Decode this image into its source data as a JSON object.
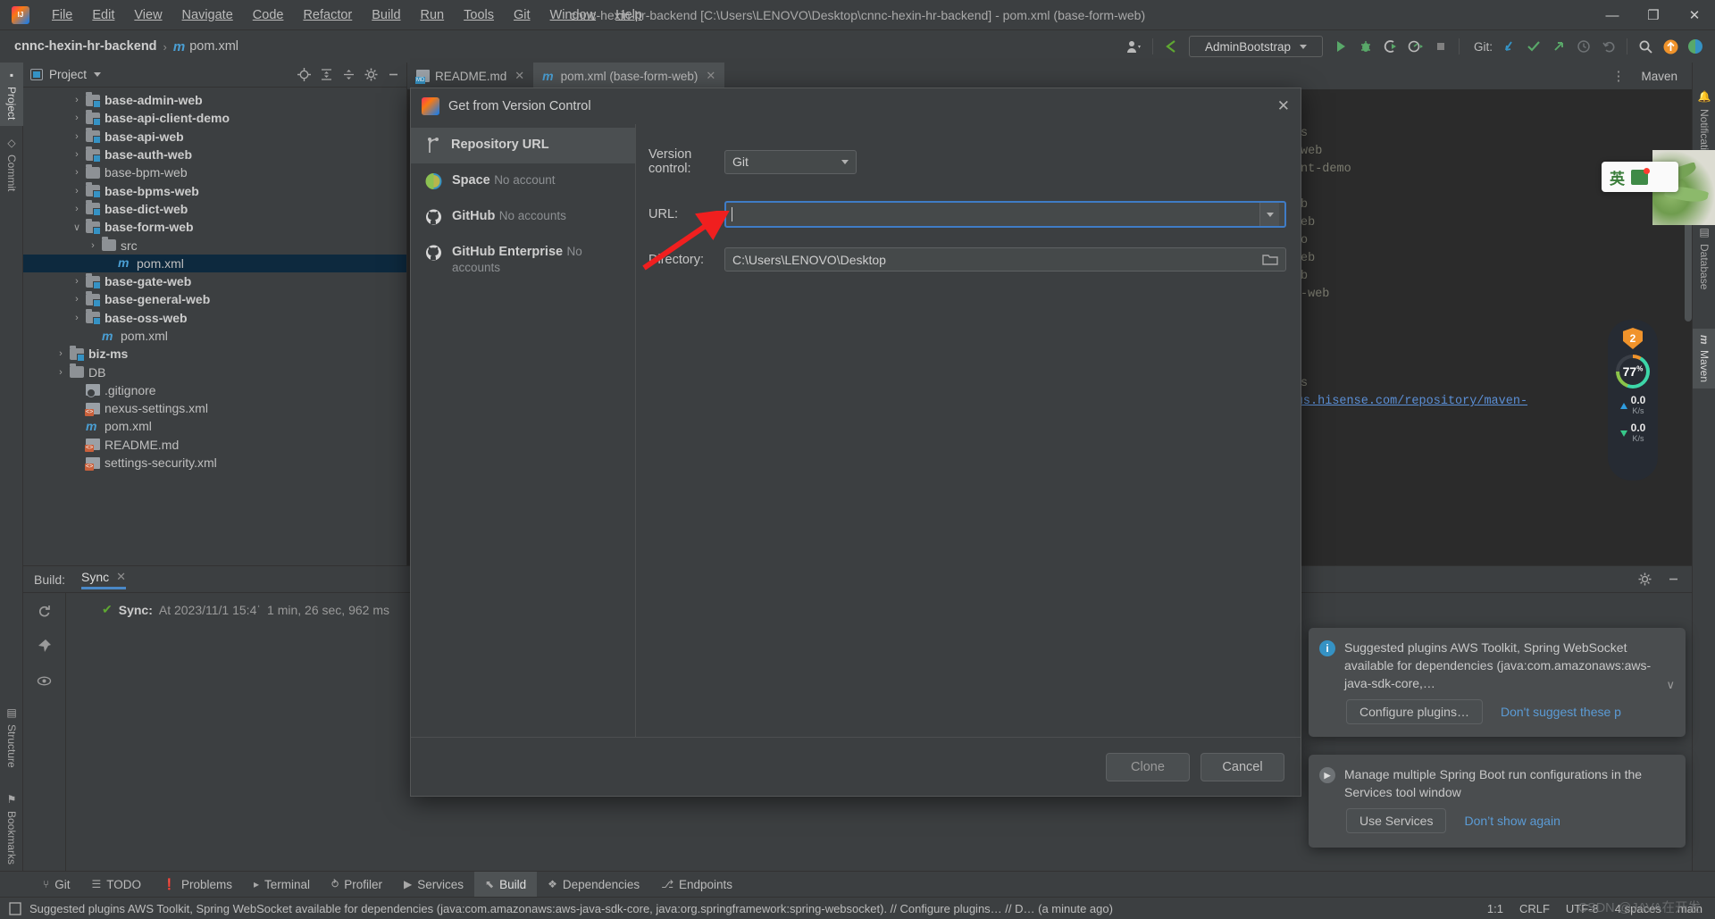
{
  "window": {
    "title": "cnnc-hexin-hr-backend [C:\\Users\\LENOVO\\Desktop\\cnnc-hexin-hr-backend] - pom.xml (base-form-web)",
    "minimize": "—",
    "maximize": "❐",
    "close": "✕"
  },
  "menu": [
    {
      "label": "File"
    },
    {
      "label": "Edit"
    },
    {
      "label": "View"
    },
    {
      "label": "Navigate"
    },
    {
      "label": "Code"
    },
    {
      "label": "Refactor"
    },
    {
      "label": "Build"
    },
    {
      "label": "Run"
    },
    {
      "label": "Tools"
    },
    {
      "label": "Git"
    },
    {
      "label": "Window"
    },
    {
      "label": "Help"
    }
  ],
  "breadcrumb": {
    "project": "cnnc-hexin-hr-backend",
    "separator": "›",
    "maven_icon": "m",
    "file": "pom.xml"
  },
  "toolbar": {
    "run_config": "AdminBootstrap",
    "git_label": "Git:",
    "icons": [
      "user-settings-icon",
      "back-arrow-icon",
      "run-icon",
      "debug-icon",
      "coverage-icon",
      "profiler-icon",
      "stop-icon",
      "git-update-icon",
      "git-commit-icon",
      "git-push-icon",
      "git-history-icon",
      "git-rollback-icon",
      "search-everywhere-icon",
      "updates-icon",
      "ide-feature-icon",
      "settings-icon"
    ]
  },
  "left_tool_strip": [
    {
      "label": "Project",
      "icon": "folder-icon",
      "selected": true
    },
    {
      "label": "Commit",
      "icon": "commit-icon",
      "selected": false
    },
    {
      "label": "Structure",
      "icon": "structure-icon",
      "selected": false
    },
    {
      "label": "Bookmarks",
      "icon": "bookmark-icon",
      "selected": false
    }
  ],
  "right_tool_strip": [
    {
      "label": "Notifications",
      "icon": "bell-icon",
      "selected": false
    },
    {
      "label": "Database",
      "icon": "database-icon",
      "selected": false
    },
    {
      "label": "Maven",
      "icon": "maven-icon",
      "selected": true
    }
  ],
  "project_panel": {
    "title": "Project",
    "header_icons": [
      "locate-icon",
      "expand-all-icon",
      "collapse-all-icon",
      "gear-icon",
      "hide-icon"
    ],
    "tree": [
      {
        "label": "base-admin-web",
        "indent": 2,
        "arrow": "›",
        "icon": "module-folder",
        "bold": true,
        "selected": false
      },
      {
        "label": "base-api-client-demo",
        "indent": 2,
        "arrow": "›",
        "icon": "module-folder",
        "bold": true,
        "selected": false
      },
      {
        "label": "base-api-web",
        "indent": 2,
        "arrow": "›",
        "icon": "module-folder",
        "bold": true,
        "selected": false
      },
      {
        "label": "base-auth-web",
        "indent": 2,
        "arrow": "›",
        "icon": "module-folder",
        "bold": true,
        "selected": false
      },
      {
        "label": "base-bpm-web",
        "indent": 2,
        "arrow": "›",
        "icon": "folder",
        "bold": false,
        "selected": false
      },
      {
        "label": "base-bpms-web",
        "indent": 2,
        "arrow": "›",
        "icon": "module-folder",
        "bold": true,
        "selected": false
      },
      {
        "label": "base-dict-web",
        "indent": 2,
        "arrow": "›",
        "icon": "module-folder",
        "bold": true,
        "selected": false
      },
      {
        "label": "base-form-web",
        "indent": 2,
        "arrow": "∨",
        "icon": "module-folder",
        "bold": true,
        "selected": false
      },
      {
        "label": "src",
        "indent": 3,
        "arrow": "›",
        "icon": "folder",
        "bold": false,
        "selected": false
      },
      {
        "label": "pom.xml",
        "indent": 4,
        "arrow": "",
        "icon": "maven",
        "bold": false,
        "selected": true
      },
      {
        "label": "base-gate-web",
        "indent": 2,
        "arrow": "›",
        "icon": "module-folder",
        "bold": true,
        "selected": false
      },
      {
        "label": "base-general-web",
        "indent": 2,
        "arrow": "›",
        "icon": "module-folder",
        "bold": true,
        "selected": false
      },
      {
        "label": "base-oss-web",
        "indent": 2,
        "arrow": "›",
        "icon": "module-folder",
        "bold": true,
        "selected": false
      },
      {
        "label": "pom.xml",
        "indent": 3,
        "arrow": "",
        "icon": "maven",
        "bold": false,
        "selected": false
      },
      {
        "label": "biz-ms",
        "indent": 1,
        "arrow": "›",
        "icon": "module-folder",
        "bold": true,
        "selected": false
      },
      {
        "label": "DB",
        "indent": 1,
        "arrow": "›",
        "icon": "folder",
        "bold": false,
        "selected": false
      },
      {
        "label": ".gitignore",
        "indent": 2,
        "arrow": "",
        "icon": "gitignore",
        "bold": false,
        "selected": false
      },
      {
        "label": "nexus-settings.xml",
        "indent": 2,
        "arrow": "",
        "icon": "xml",
        "bold": false,
        "selected": false
      },
      {
        "label": "pom.xml",
        "indent": 2,
        "arrow": "",
        "icon": "maven",
        "bold": false,
        "selected": false
      },
      {
        "label": "README.md",
        "indent": 2,
        "arrow": "",
        "icon": "xml",
        "bold": false,
        "selected": false
      },
      {
        "label": "settings-security.xml",
        "indent": 2,
        "arrow": "",
        "icon": "xml",
        "bold": false,
        "selected": false
      }
    ]
  },
  "editor": {
    "tabs": [
      {
        "label": "README.md",
        "icon": "markdown-icon",
        "active": false,
        "close": "✕"
      },
      {
        "label": "pom.xml (base-form-web)",
        "icon": "maven-icon",
        "active": true,
        "close": "✕"
      }
    ],
    "maven_panel_title": "Maven",
    "more_icon": "⋮",
    "background_text": [
      "s",
      "web",
      "nt-demo",
      "",
      "b",
      "eb",
      "o",
      "eb",
      "b",
      "-web",
      "",
      "",
      "",
      "",
      "s"
    ],
    "code_link": "tp://nexus.hisense.com/repository/maven-"
  },
  "build_panel": {
    "label": "Build:",
    "tab": "Sync",
    "tab_close": "✕",
    "sync_status_prefix": "Sync:",
    "sync_status_time": "At 2023/11/1 15:4ˈ",
    "sync_duration": "1 min, 26 sec, 962 ms",
    "gutter_icons": [
      "rerun-icon",
      "pin-icon",
      "eye-icon"
    ],
    "header_icons": [
      "gear-icon",
      "hide-icon"
    ]
  },
  "dialog": {
    "title": "Get from Version Control",
    "icon": "intellij-icon",
    "close": "✕",
    "sidebar": [
      {
        "name": "Repository URL",
        "sub": "",
        "icon": "branch-icon",
        "selected": true
      },
      {
        "name": "Space",
        "sub": "No account",
        "icon": "space-icon",
        "selected": false
      },
      {
        "name": "GitHub",
        "sub": "No accounts",
        "icon": "github-icon",
        "selected": false
      },
      {
        "name": "GitHub Enterprise",
        "sub": "No accounts",
        "icon": "github-icon",
        "selected": false
      }
    ],
    "version_control_label": "Version control:",
    "version_control_value": "Git",
    "url_label": "URL:",
    "url_value": "",
    "url_placeholder": "",
    "directory_label": "Directory:",
    "directory_value": "C:\\Users\\LENOVO\\Desktop",
    "browse_icon": "folder-open-icon",
    "clone_button": "Clone",
    "cancel_button": "Cancel",
    "annotation": "red-arrow-pointing-to-url-field"
  },
  "notifications": [
    {
      "icon": "info-icon",
      "text": "Suggested plugins AWS Toolkit, Spring WebSocket available for dependencies (java:com.amazonaws:aws-java-sdk-core,…",
      "button": "Configure plugins…",
      "link": "Don't suggest these p",
      "chevron": "∨"
    },
    {
      "icon": "run-icon",
      "text": "Manage multiple Spring Boot run configurations in the Services tool window",
      "button": "Use Services",
      "link": "Don’t show again",
      "chevron": ""
    }
  ],
  "net_widget": {
    "badge": "2",
    "percent": "77",
    "percent_unit": "%",
    "upload": "0.0",
    "upload_unit": "K/s",
    "download": "0.0",
    "download_unit": "K/s"
  },
  "ime_widget": {
    "mode": "英",
    "icon": "ime-shirt-icon"
  },
  "bottom_tabs": [
    {
      "label": "Git",
      "icon": "git-icon",
      "selected": false
    },
    {
      "label": "TODO",
      "icon": "todo-icon",
      "selected": false
    },
    {
      "label": "Problems",
      "icon": "problems-icon",
      "selected": false
    },
    {
      "label": "Terminal",
      "icon": "terminal-icon",
      "selected": false
    },
    {
      "label": "Profiler",
      "icon": "profiler-icon",
      "selected": false
    },
    {
      "label": "Services",
      "icon": "services-icon",
      "selected": false
    },
    {
      "label": "Build",
      "icon": "build-icon",
      "selected": true
    },
    {
      "label": "Dependencies",
      "icon": "dependencies-icon",
      "selected": false
    },
    {
      "label": "Endpoints",
      "icon": "endpoints-icon",
      "selected": false
    }
  ],
  "status_bar": {
    "icon": "notification-icon",
    "message": "Suggested plugins AWS Toolkit, Spring WebSocket available for dependencies (java:com.amazonaws:aws-java-sdk-core, java:org.springframework:spring-websocket). // Configure plugins… // D… (a minute ago)",
    "caret": "1:1",
    "line_separator": "CRLF",
    "encoding": "UTF-8",
    "indent": "4 spaces",
    "branch": "main",
    "watermark": "CSDN @JAVA在开发"
  }
}
